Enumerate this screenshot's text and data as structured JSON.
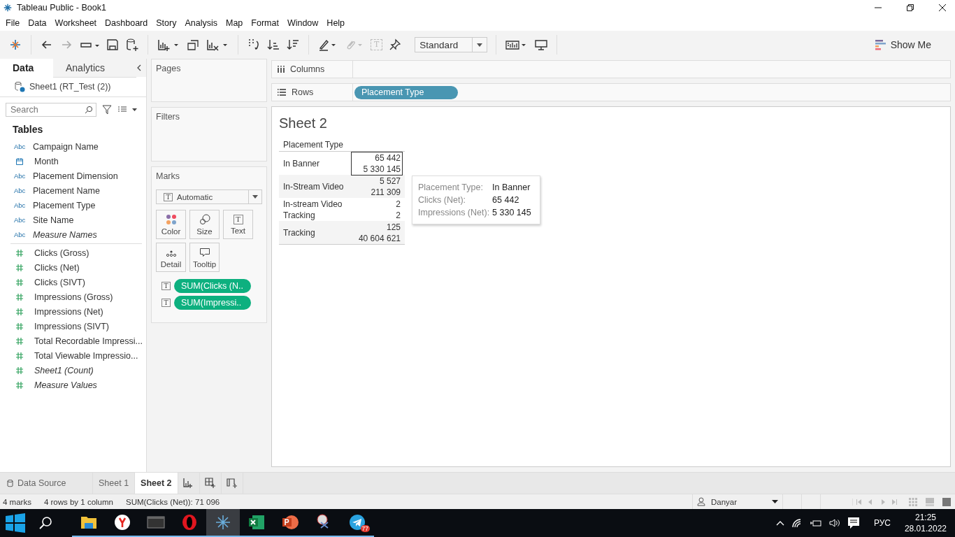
{
  "window": {
    "title": "Tableau Public - Book1"
  },
  "menu": [
    "File",
    "Data",
    "Worksheet",
    "Dashboard",
    "Story",
    "Analysis",
    "Map",
    "Format",
    "Window",
    "Help"
  ],
  "toolbar": {
    "text_glyph": "T",
    "mark_type": "Standard",
    "show_me": "Show Me"
  },
  "data_pane": {
    "tabs": [
      {
        "label": "Data",
        "selected": true
      },
      {
        "label": "Analytics",
        "selected": false
      }
    ],
    "data_source": "Sheet1 (RT_Test (2))",
    "search": {
      "placeholder": "Search"
    },
    "heading": "Tables",
    "fields": [
      {
        "name": "Campaign Name",
        "kind": "dimension",
        "type_label": "Abc",
        "italic": false
      },
      {
        "name": "Month",
        "kind": "date",
        "italic": false
      },
      {
        "name": "Placement Dimension",
        "kind": "dimension",
        "type_label": "Abc",
        "italic": false
      },
      {
        "name": "Placement Name",
        "kind": "dimension",
        "type_label": "Abc",
        "italic": false
      },
      {
        "name": "Placement Type",
        "kind": "dimension",
        "type_label": "Abc",
        "italic": false
      },
      {
        "name": "Site Name",
        "kind": "dimension",
        "type_label": "Abc",
        "italic": false
      },
      {
        "name": "Measure Names",
        "kind": "dimension",
        "type_label": "Abc",
        "italic": true
      },
      {
        "name": "Clicks (Gross)",
        "kind": "measure",
        "italic": false
      },
      {
        "name": "Clicks (Net)",
        "kind": "measure",
        "italic": false
      },
      {
        "name": "Clicks (SIVT)",
        "kind": "measure",
        "italic": false
      },
      {
        "name": "Impressions (Gross)",
        "kind": "measure",
        "italic": false
      },
      {
        "name": "Impressions (Net)",
        "kind": "measure",
        "italic": false
      },
      {
        "name": "Impressions (SIVT)",
        "kind": "measure",
        "italic": false
      },
      {
        "name": "Total Recordable Impressi...",
        "kind": "measure",
        "italic": false
      },
      {
        "name": "Total Viewable Impressio...",
        "kind": "measure",
        "italic": false
      },
      {
        "name": "Sheet1 (Count)",
        "kind": "measure",
        "italic": true
      },
      {
        "name": "Measure Values",
        "kind": "measure",
        "italic": true
      }
    ]
  },
  "pages": {
    "title": "Pages"
  },
  "filters": {
    "title": "Filters"
  },
  "marks": {
    "title": "Marks",
    "mark_type": {
      "label": "Automatic",
      "glyph": "T"
    },
    "cards": [
      {
        "label": "Color",
        "kind": "color"
      },
      {
        "label": "Size",
        "kind": "size"
      },
      {
        "label": "Text",
        "kind": "text",
        "glyph": "T"
      },
      {
        "label": "Detail",
        "kind": "detail"
      },
      {
        "label": "Tooltip",
        "kind": "tooltip"
      }
    ],
    "pills": [
      {
        "label": "SUM(Clicks (N..",
        "glyph": "T"
      },
      {
        "label": "SUM(Impressi..",
        "glyph": "T"
      }
    ]
  },
  "columns_shelf": {
    "label": "Columns"
  },
  "rows_shelf": {
    "label": "Rows",
    "pills": [
      "Placement Type"
    ]
  },
  "sheet": {
    "title": "Sheet 2",
    "header": "Placement Type",
    "rows": [
      {
        "label": "In Banner",
        "values": [
          "65 442",
          "5 330 145"
        ],
        "selected": true
      },
      {
        "label": "In-Stream Video",
        "values": [
          "5 527",
          "211 309"
        ],
        "selected": false
      },
      {
        "label": "In-stream Video Tracking",
        "values": [
          "2",
          "2"
        ],
        "selected": false
      },
      {
        "label": "Tracking",
        "values": [
          "125",
          "40 604 621"
        ],
        "selected": false
      }
    ],
    "tooltip": [
      {
        "label": "Placement Type:",
        "value": "In Banner"
      },
      {
        "label": "Clicks (Net):",
        "value": "65 442"
      },
      {
        "label": "Impressions (Net):",
        "value": "5 330 145"
      }
    ]
  },
  "sheet_tabs": [
    {
      "label": "Data Source",
      "kind": "datasource",
      "selected": false
    },
    {
      "label": "Sheet 1",
      "kind": "sheet",
      "selected": false
    },
    {
      "label": "Sheet 2",
      "kind": "sheet",
      "selected": true
    }
  ],
  "status_bar": {
    "items": [
      "4 marks",
      "4 rows by 1 column",
      "SUM(Clicks (Net)): 71 096"
    ],
    "user": "Danyar"
  },
  "taskbar": {
    "apps": [
      {
        "kind": "folder",
        "running": true,
        "active": false
      },
      {
        "kind": "y",
        "running": true,
        "active": false
      },
      {
        "kind": "terminal",
        "running": true,
        "active": false
      },
      {
        "kind": "ring",
        "running": true,
        "active": false
      },
      {
        "kind": "cross",
        "running": true,
        "active": true
      },
      {
        "kind": "sheet",
        "running": true,
        "active": false
      },
      {
        "kind": "slides",
        "running": true,
        "active": false
      },
      {
        "kind": "scissors",
        "running": true,
        "active": false
      },
      {
        "kind": "plane",
        "running": true,
        "active": false,
        "badge": "77"
      }
    ],
    "language": "РУС",
    "time": "21:25",
    "date": "28.01.2022"
  }
}
